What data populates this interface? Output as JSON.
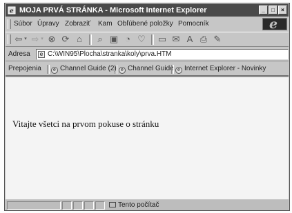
{
  "window": {
    "title": "MOJA PRVÁ STRÁNKA - Microsoft Internet Explorer",
    "buttons": [
      "_",
      "□",
      "×"
    ]
  },
  "menu": {
    "items": [
      "Súbor",
      "Úpravy",
      "Zobraziť",
      "Kam",
      "Obľúbené položky",
      "Pomocník"
    ],
    "logo": "e"
  },
  "toolbar": {
    "icons": [
      "back-icon",
      "forward-icon",
      "stop-icon",
      "refresh-icon",
      "home-icon",
      "search-icon",
      "favorites-icon",
      "history-icon",
      "channels-icon",
      "fullscreen-icon",
      "mail-icon",
      "font-icon",
      "print-icon",
      "edit-icon"
    ]
  },
  "address": {
    "label": "Adresa",
    "url": "C:\\WIN95\\Plocha\\stranka\\koly\\prva.HTM"
  },
  "links": {
    "label": "Prepojenia",
    "items": [
      "Channel Guide (2)",
      "Channel Guide",
      "Internet Explorer - Novinky"
    ]
  },
  "page": {
    "text": "Vitajte všetci na prvom pokuse o stránku"
  },
  "status": {
    "zone": "Tento počítač"
  }
}
